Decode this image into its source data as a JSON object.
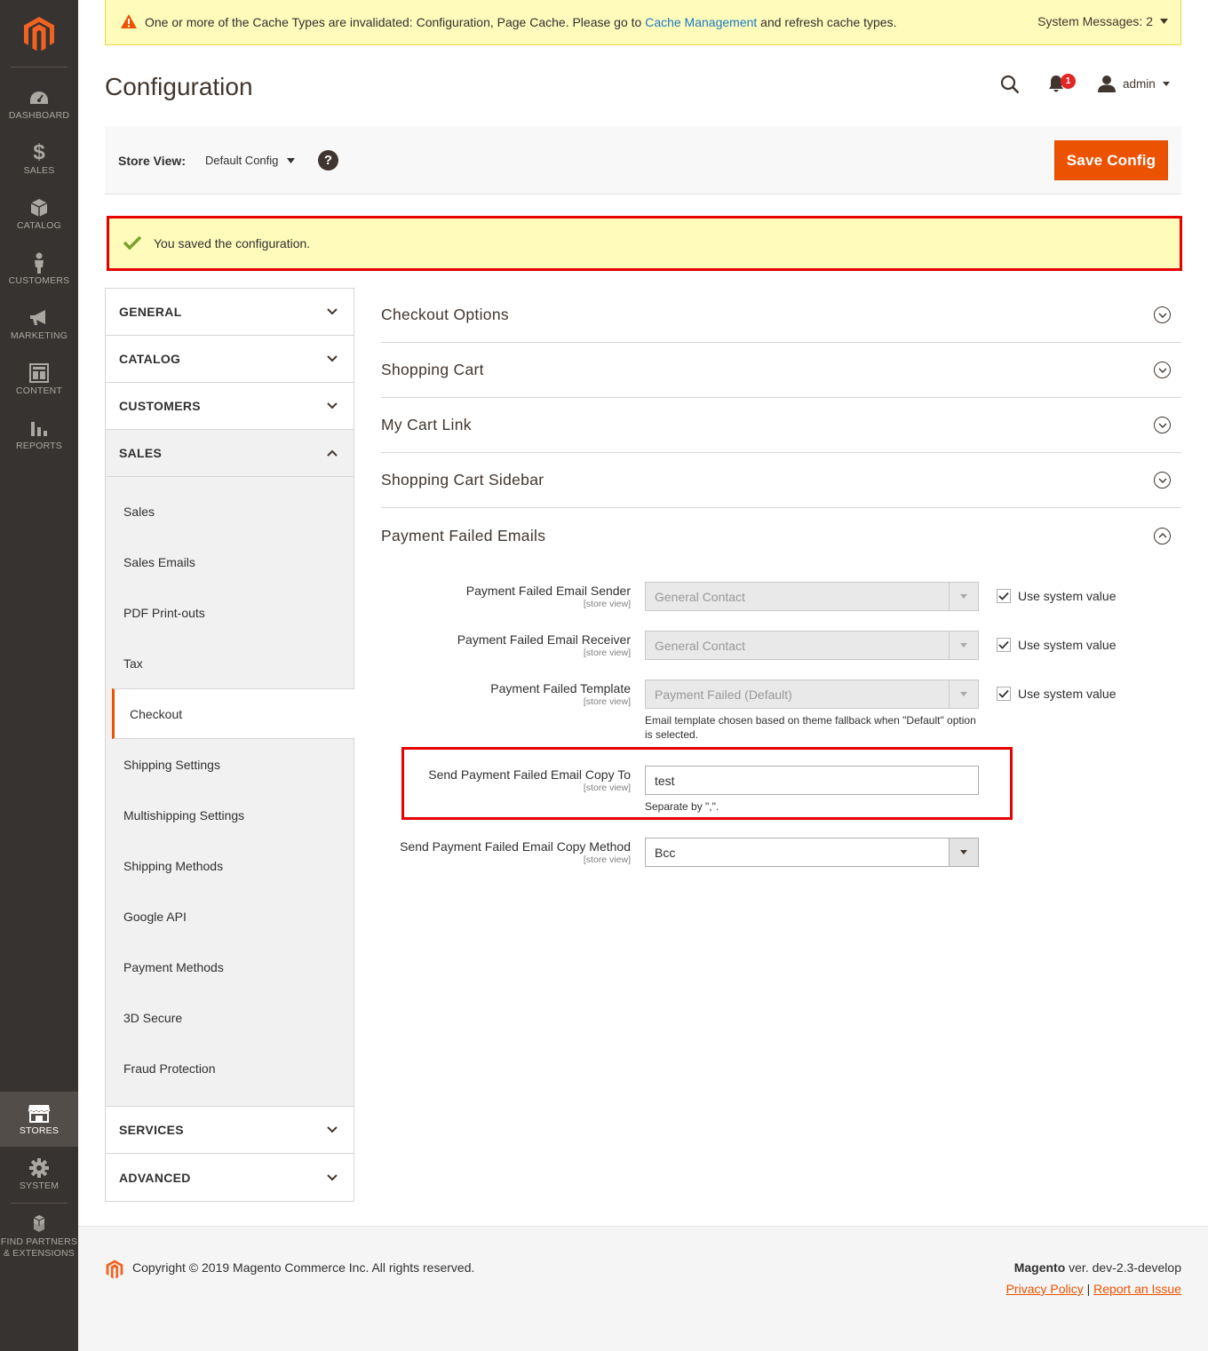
{
  "nav": {
    "items": [
      {
        "label": "DASHBOARD",
        "icon": "dashboard-icon"
      },
      {
        "label": "SALES",
        "icon": "dollar-icon"
      },
      {
        "label": "CATALOG",
        "icon": "box-icon"
      },
      {
        "label": "CUSTOMERS",
        "icon": "person-icon"
      },
      {
        "label": "MARKETING",
        "icon": "megaphone-icon"
      },
      {
        "label": "CONTENT",
        "icon": "layout-icon"
      },
      {
        "label": "REPORTS",
        "icon": "bar-chart-icon"
      },
      {
        "label": "STORES",
        "icon": "store-icon"
      },
      {
        "label": "SYSTEM",
        "icon": "gear-icon"
      },
      {
        "label_line1": "FIND PARTNERS",
        "label_line2": "& EXTENSIONS",
        "icon": "cubes-icon"
      }
    ]
  },
  "system_message": {
    "text_before": "One or more of the Cache Types are invalidated: Configuration, Page Cache. Please go to",
    "link": "Cache Management",
    "text_after": "and refresh cache types.",
    "count_label": "System Messages: 2"
  },
  "header": {
    "title": "Configuration",
    "notification_count": "1",
    "user": "admin"
  },
  "store_view": {
    "label": "Store View:",
    "value": "Default Config",
    "help": "?",
    "save_label": "Save Config"
  },
  "success_message": "You saved the configuration.",
  "tabs": {
    "general": "GENERAL",
    "catalog": "CATALOG",
    "customers": "CUSTOMERS",
    "sales": "SALES",
    "sales_items": [
      "Sales",
      "Sales Emails",
      "PDF Print-outs",
      "Tax",
      "Checkout",
      "Shipping Settings",
      "Multishipping Settings",
      "Shipping Methods",
      "Google API",
      "Payment Methods",
      "3D Secure",
      "Fraud Protection"
    ],
    "services": "SERVICES",
    "advanced": "ADVANCED"
  },
  "sections": [
    "Checkout Options",
    "Shopping Cart",
    "My Cart Link",
    "Shopping Cart Sidebar",
    "Payment Failed Emails"
  ],
  "fields": {
    "scope": "[store view]",
    "use_system": "Use system value",
    "sender_label": "Payment Failed Email Sender",
    "sender_value": "General Contact",
    "receiver_label": "Payment Failed Email Receiver",
    "receiver_value": "General Contact",
    "template_label": "Payment Failed Template",
    "template_value": "Payment Failed (Default)",
    "template_note": "Email template chosen based on theme fallback when \"Default\" option is selected.",
    "copy_to_label": "Send Payment Failed Email Copy To",
    "copy_to_value": "test",
    "copy_to_note": "Separate by \",\".",
    "copy_method_label": "Send Payment Failed Email Copy Method",
    "copy_method_value": "Bcc"
  },
  "footer": {
    "copyright": "Copyright © 2019 Magento Commerce Inc. All rights reserved.",
    "brand": "Magento",
    "version": " ver. dev-2.3-develop",
    "privacy": "Privacy Policy",
    "separator": "|",
    "report": "Report an Issue"
  },
  "colors": {
    "accent": "#eb5202",
    "nav_bg": "#373330",
    "notice_bg": "#fffbbb",
    "highlight": "#e60000",
    "link": "#1979c3"
  }
}
